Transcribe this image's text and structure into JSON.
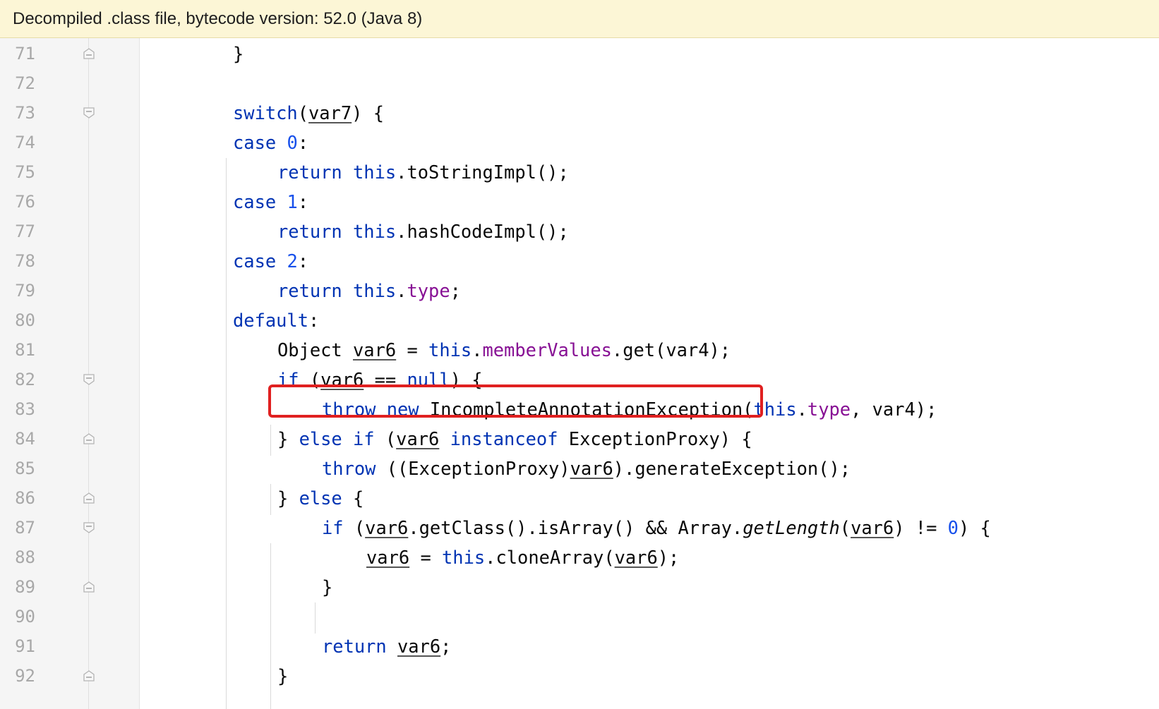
{
  "banner": {
    "text": "Decompiled .class file, bytecode version: 52.0 (Java 8)"
  },
  "lines": [
    {
      "num": "71",
      "fold": "end"
    },
    {
      "num": "72",
      "fold": ""
    },
    {
      "num": "73",
      "fold": "start"
    },
    {
      "num": "74",
      "fold": ""
    },
    {
      "num": "75",
      "fold": ""
    },
    {
      "num": "76",
      "fold": ""
    },
    {
      "num": "77",
      "fold": ""
    },
    {
      "num": "78",
      "fold": ""
    },
    {
      "num": "79",
      "fold": ""
    },
    {
      "num": "80",
      "fold": ""
    },
    {
      "num": "81",
      "fold": ""
    },
    {
      "num": "82",
      "fold": "start"
    },
    {
      "num": "83",
      "fold": ""
    },
    {
      "num": "84",
      "fold": "end"
    },
    {
      "num": "85",
      "fold": ""
    },
    {
      "num": "86",
      "fold": "end"
    },
    {
      "num": "87",
      "fold": "start"
    },
    {
      "num": "88",
      "fold": ""
    },
    {
      "num": "89",
      "fold": "end"
    },
    {
      "num": "90",
      "fold": ""
    },
    {
      "num": "91",
      "fold": ""
    },
    {
      "num": "92",
      "fold": "end"
    }
  ],
  "code": {
    "l71": [
      "}"
    ],
    "l73": [
      "switch",
      "(",
      "var7",
      ") {"
    ],
    "l74": [
      "case ",
      "0",
      ":"
    ],
    "l75": [
      "return ",
      "this",
      ".toStringImpl();"
    ],
    "l76": [
      "case ",
      "1",
      ":"
    ],
    "l77": [
      "return ",
      "this",
      ".hashCodeImpl();"
    ],
    "l78": [
      "case ",
      "2",
      ":"
    ],
    "l79": [
      "return ",
      "this",
      ".",
      "type",
      ";"
    ],
    "l80": [
      "default",
      ":"
    ],
    "l81": [
      "Object ",
      "var6",
      " = ",
      "this",
      ".",
      "memberValues",
      ".get(var4);"
    ],
    "l82": [
      "if ",
      "(",
      "var6",
      " == ",
      "null",
      ") {"
    ],
    "l83": [
      "throw ",
      "new ",
      "IncompleteAnnotationException(",
      "this",
      ".",
      "type",
      ", var4);"
    ],
    "l84": [
      "} ",
      "else if ",
      "(",
      "var6",
      " ",
      "instanceof ",
      "ExceptionProxy) {"
    ],
    "l85": [
      "throw ",
      "((ExceptionProxy)",
      "var6",
      ").generateException();"
    ],
    "l86": [
      "} ",
      "else ",
      "{"
    ],
    "l87": [
      "if ",
      "(",
      "var6",
      ".getClass().isArray() && Array.",
      "getLength",
      "(",
      "var6",
      ") != ",
      "0",
      ") {"
    ],
    "l88": [
      "var6",
      " = ",
      "this",
      ".cloneArray(",
      "var6",
      ");"
    ],
    "l89": [
      "}"
    ],
    "l91": [
      "return ",
      "var6",
      ";"
    ],
    "l92": [
      "}"
    ]
  },
  "colors": {
    "keyword": "#0033b3",
    "number": "#1750eb",
    "field": "#871094",
    "highlight_box": "#e02020",
    "banner_bg": "#fcf6d6"
  }
}
